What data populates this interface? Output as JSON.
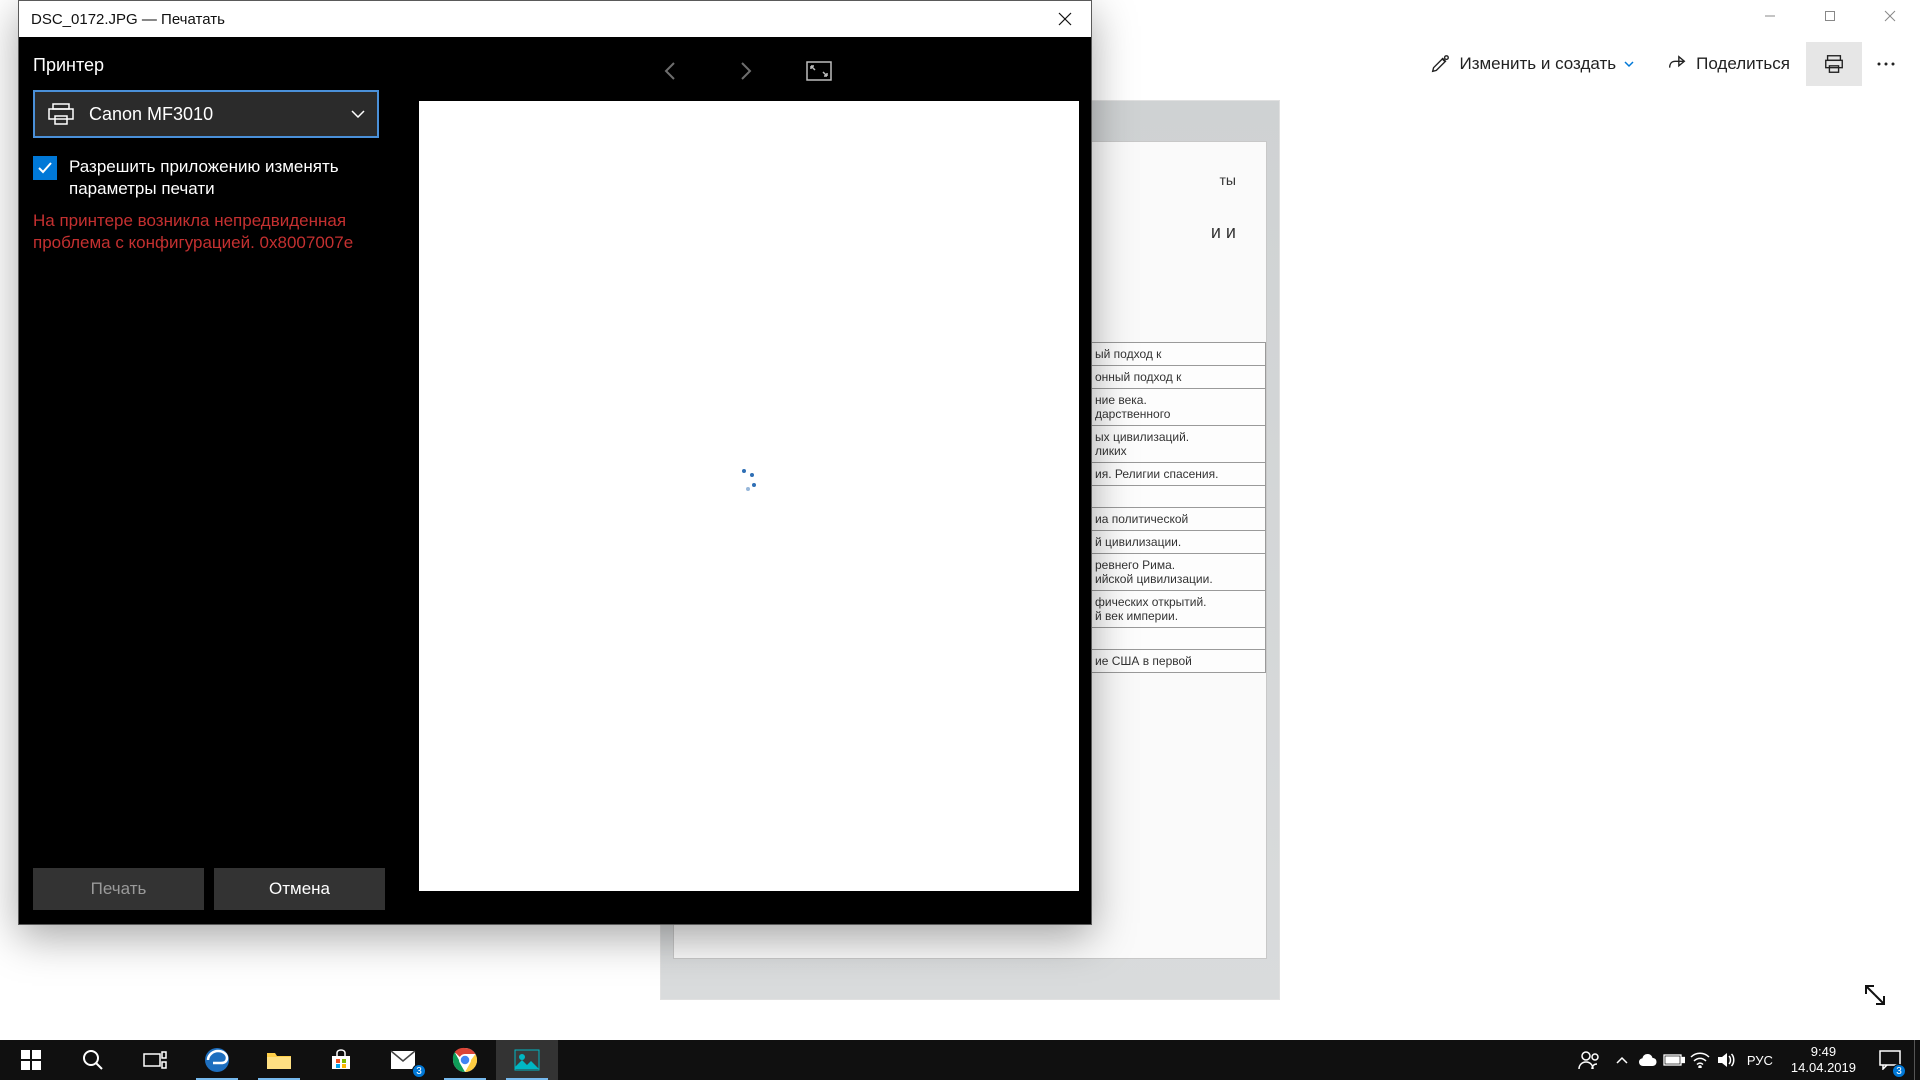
{
  "photos_app": {
    "edit_create": "Изменить и создать",
    "share": "Поделиться"
  },
  "doc_snippets": {
    "h1": "ты",
    "h2": "и и",
    "rows": [
      "ый подход к",
      "онный подход к",
      "ние века.\nдарственного",
      "ых цивилизаций.\nликих",
      "ия. Религии спасения.",
      "",
      "иа политической",
      "й цивилизации.",
      "ревнего Рима.\nийской цивилизации.",
      "фических открытий.\nй век империи.",
      "",
      "ие США в первой"
    ]
  },
  "print_dialog": {
    "title": "DSC_0172.JPG — Печатать",
    "printer_label": "Принтер",
    "printer_name": "Canon MF3010",
    "allow_change": "Разрешить приложению изменять параметры печати",
    "error": "На принтере возникла непредвиденная проблема с конфигурацией. 0x8007007e",
    "print_btn": "Печать",
    "cancel_btn": "Отмена"
  },
  "taskbar": {
    "lang": "РУС",
    "time": "9:49",
    "date": "14.04.2019",
    "mail_badge": "3",
    "notif_badge": "3"
  }
}
